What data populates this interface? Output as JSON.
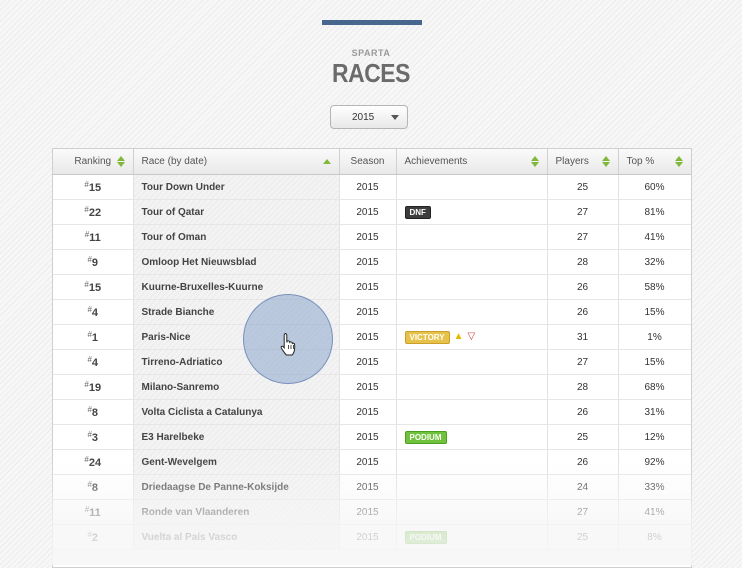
{
  "header": {
    "team": "SPARTA",
    "title": "RACES"
  },
  "season_select": {
    "value": "2015"
  },
  "table": {
    "columns": {
      "ranking": "Ranking",
      "race": "Race (by date)",
      "season": "Season",
      "achievements": "Achievements",
      "players": "Players",
      "top": "Top %"
    },
    "rows": [
      {
        "rank": "15",
        "race": "Tour Down Under",
        "season": "2015",
        "badge": "",
        "players": "25",
        "top": "60%"
      },
      {
        "rank": "22",
        "race": "Tour of Qatar",
        "season": "2015",
        "badge": "DNF",
        "players": "27",
        "top": "81%"
      },
      {
        "rank": "11",
        "race": "Tour of Oman",
        "season": "2015",
        "badge": "",
        "players": "27",
        "top": "41%"
      },
      {
        "rank": "9",
        "race": "Omloop Het Nieuwsblad",
        "season": "2015",
        "badge": "",
        "players": "28",
        "top": "32%"
      },
      {
        "rank": "15",
        "race": "Kuurne-Bruxelles-Kuurne",
        "season": "2015",
        "badge": "",
        "players": "26",
        "top": "58%"
      },
      {
        "rank": "4",
        "race": "Strade Bianche",
        "season": "2015",
        "badge": "",
        "players": "26",
        "top": "15%"
      },
      {
        "rank": "1",
        "race": "Paris-Nice",
        "season": "2015",
        "badge": "VICTORY",
        "jerseys": true,
        "players": "31",
        "top": "1%"
      },
      {
        "rank": "4",
        "race": "Tirreno-Adriatico",
        "season": "2015",
        "badge": "",
        "players": "27",
        "top": "15%"
      },
      {
        "rank": "19",
        "race": "Milano-Sanremo",
        "season": "2015",
        "badge": "",
        "players": "28",
        "top": "68%"
      },
      {
        "rank": "8",
        "race": "Volta Ciclista a Catalunya",
        "season": "2015",
        "badge": "",
        "players": "26",
        "top": "31%"
      },
      {
        "rank": "3",
        "race": "E3 Harelbeke",
        "season": "2015",
        "badge": "PODIUM",
        "players": "25",
        "top": "12%"
      },
      {
        "rank": "24",
        "race": "Gent-Wevelgem",
        "season": "2015",
        "badge": "",
        "players": "26",
        "top": "92%"
      },
      {
        "rank": "8",
        "race": "Driedaagse De Panne-Koksijde",
        "season": "2015",
        "badge": "",
        "players": "24",
        "top": "33%"
      },
      {
        "rank": "11",
        "race": "Ronde van Vlaanderen",
        "season": "2015",
        "badge": "",
        "players": "27",
        "top": "41%"
      },
      {
        "rank": "2",
        "race": "Vuelta al País Vasco",
        "season": "2015",
        "badge": "PODIUM",
        "players": "25",
        "top": "8%"
      }
    ]
  },
  "colors": {
    "accent_bar": "#48678f",
    "sort_arrow": "#7fb83a",
    "dnf": "#3d3d3d",
    "victory": "#e6c24a",
    "podium": "#6fc23b"
  },
  "icons": {
    "jersey_yellow": "yellow-jersey-icon",
    "jersey_polka": "polka-dot-jersey-icon",
    "cursor": "hand-pointer-icon"
  }
}
